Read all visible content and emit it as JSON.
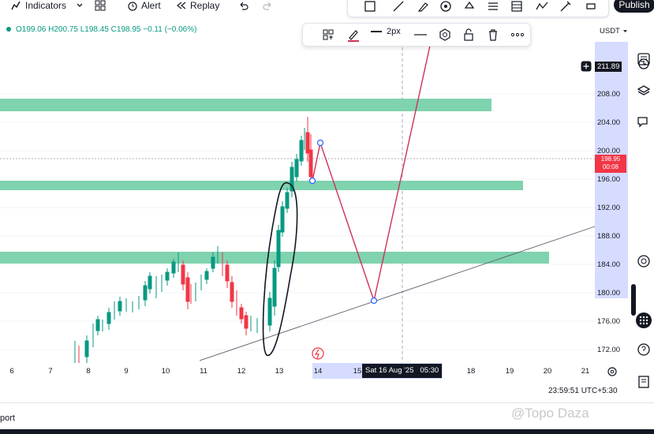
{
  "topbar": {
    "indicators_label": "Indicators",
    "alert_label": "Alert",
    "replay_label": "Replay",
    "publish_label": "Publish"
  },
  "ohlc": {
    "text": "O199.06 H200.75 L198.45 C198.95 −0.11 (−0.06%)"
  },
  "drawing_toolbar": {
    "line_width_label": "2px"
  },
  "price_axis": {
    "currency_label": "USDT",
    "top_price_badge": "211.89",
    "current_price": "198.95",
    "countdown": "00:08",
    "ticks": [
      "208.00",
      "204.00",
      "200.00",
      "196.00",
      "192.00",
      "188.00",
      "184.00",
      "180.00",
      "176.00",
      "172.00"
    ]
  },
  "time_axis": {
    "ticks": [
      "6",
      "7",
      "8",
      "9",
      "10",
      "11",
      "12",
      "13",
      "14",
      "15",
      "18",
      "19",
      "20",
      "21"
    ],
    "crosshair_label": "Sat 16 Aug '25   05:30"
  },
  "status": {
    "clock": "23:59:51 UTC+5:30",
    "bottom_left_label": "port",
    "watermark": "@Topo Daza"
  },
  "colors": {
    "zone_green": "#7fd3ae",
    "red_path": "#cc3355",
    "price_badge_red": "#f23645",
    "candle_up": "#089981",
    "candle_down": "#f23645",
    "axis_highlight": "#d6dcff"
  }
}
